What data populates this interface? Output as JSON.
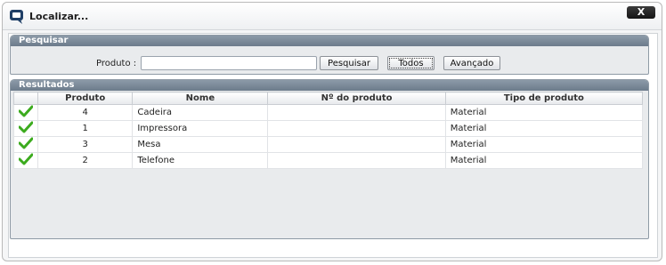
{
  "window": {
    "title": "Localizar...",
    "close_label": "X"
  },
  "search": {
    "header": "Pesquisar",
    "produto_label": "Produto :",
    "produto_value": "",
    "buttons": {
      "search": "Pesquisar",
      "all": "Todos",
      "advanced": "Avançado"
    }
  },
  "results": {
    "header": "Resultados",
    "columns": [
      "",
      "Produto",
      "Nome",
      "Nº do produto",
      "Tipo de produto"
    ],
    "rows": [
      {
        "produto": "4",
        "nome": "Cadeira",
        "numero": "",
        "tipo": "Material"
      },
      {
        "produto": "1",
        "nome": "Impressora",
        "numero": "",
        "tipo": "Material"
      },
      {
        "produto": "3",
        "nome": "Mesa",
        "numero": "",
        "tipo": "Material"
      },
      {
        "produto": "2",
        "nome": "Telefone",
        "numero": "",
        "tipo": "Material"
      }
    ]
  },
  "colors": {
    "header_bar": "#7b8a99",
    "check": "#3cab1e",
    "close_bg": "#222222"
  },
  "icons": {
    "app": "chat-bubble-icon",
    "row_select": "checkmark-icon"
  }
}
